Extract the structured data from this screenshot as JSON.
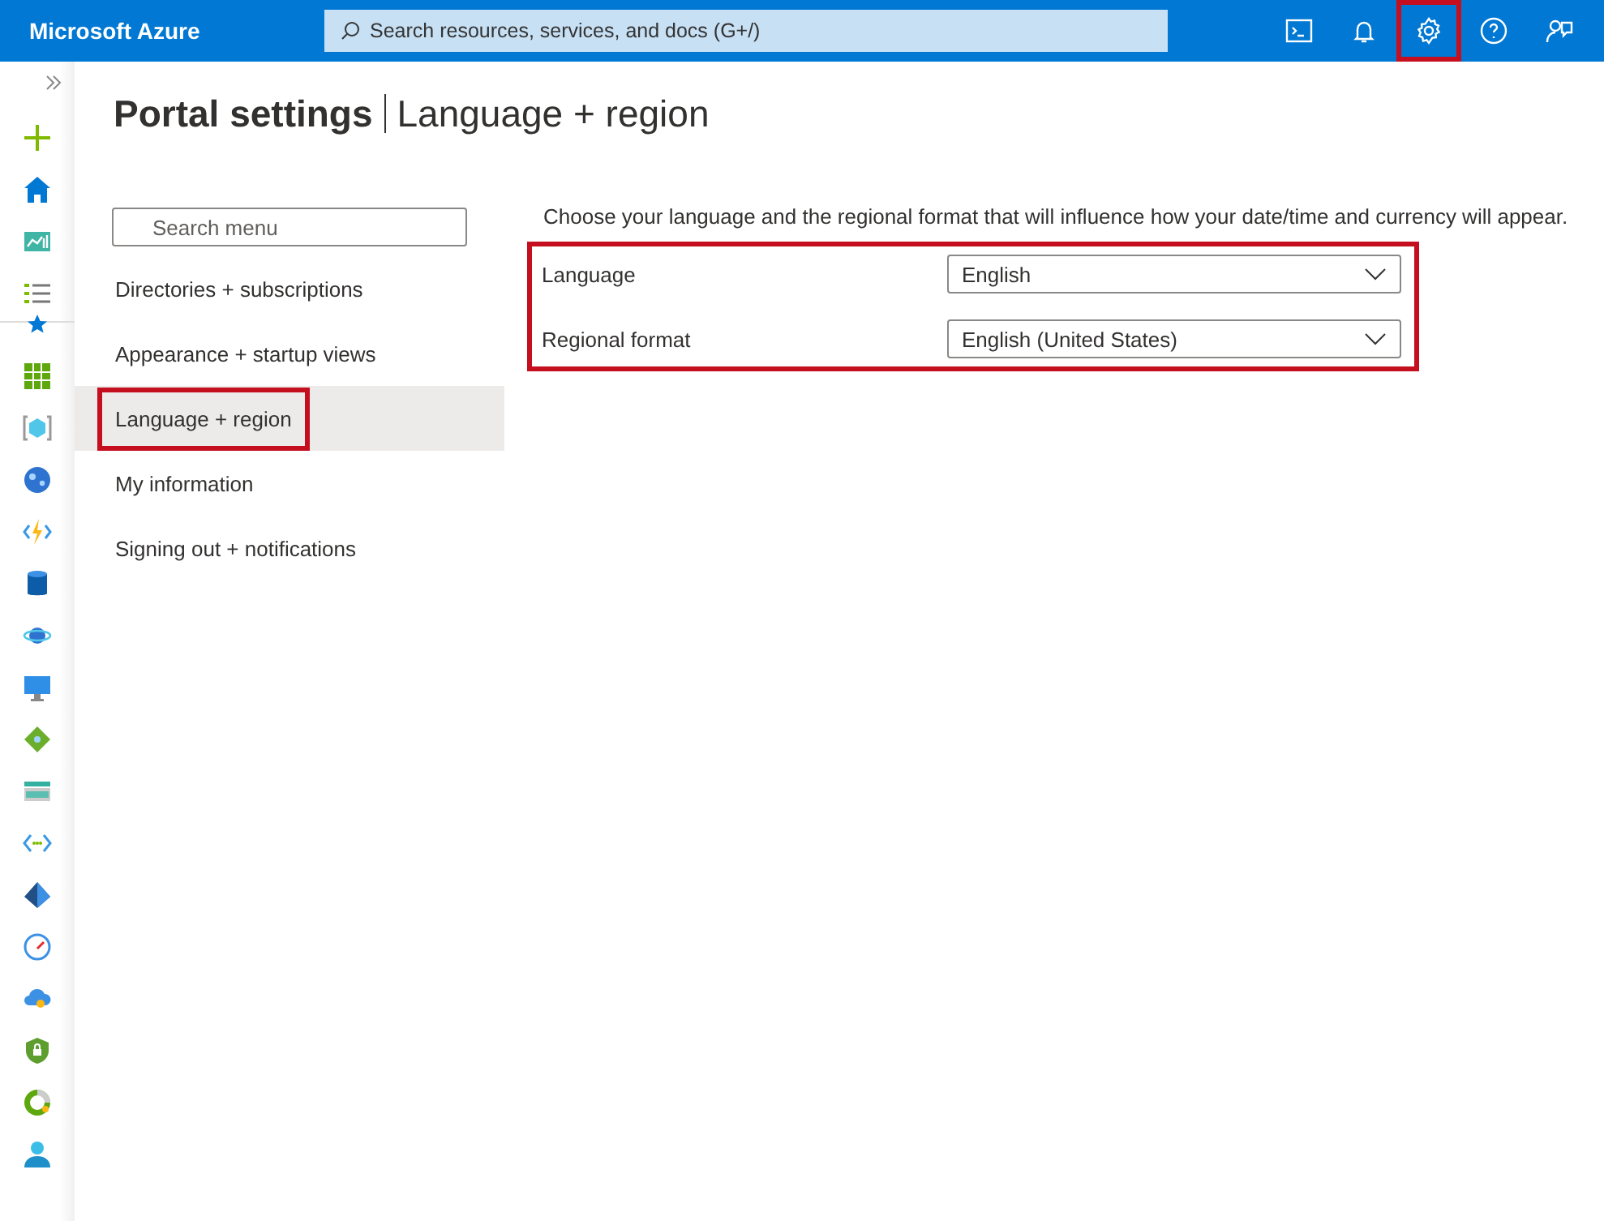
{
  "topbar": {
    "brand": "Microsoft Azure",
    "search": {
      "placeholder": "Search resources, services, and docs (G+/)"
    },
    "actions": [
      {
        "kind": "shell",
        "highlighted": false
      },
      {
        "kind": "bell",
        "highlighted": false
      },
      {
        "kind": "gear",
        "highlighted": true
      },
      {
        "kind": "help",
        "highlighted": false
      },
      {
        "kind": "feedback",
        "highlighted": false
      }
    ]
  },
  "page": {
    "title": "Portal settings",
    "subtitle": "Language + region"
  },
  "menu": {
    "search": {
      "placeholder": "Search menu"
    },
    "items": [
      {
        "label": "Directories + subscriptions",
        "selected": false,
        "highlighted": false
      },
      {
        "label": "Appearance + startup views",
        "selected": false,
        "highlighted": false
      },
      {
        "label": "Language + region",
        "selected": true,
        "highlighted": true
      },
      {
        "label": "My information",
        "selected": false,
        "highlighted": false
      },
      {
        "label": "Signing out + notifications",
        "selected": false,
        "highlighted": false
      }
    ]
  },
  "content": {
    "intro": "Choose your language and the regional format that will influence how your date/time and currency will appear.",
    "highlighted": true,
    "fields": [
      {
        "label": "Language",
        "value": "English"
      },
      {
        "label": "Regional format",
        "value": "English (United States)"
      }
    ]
  }
}
